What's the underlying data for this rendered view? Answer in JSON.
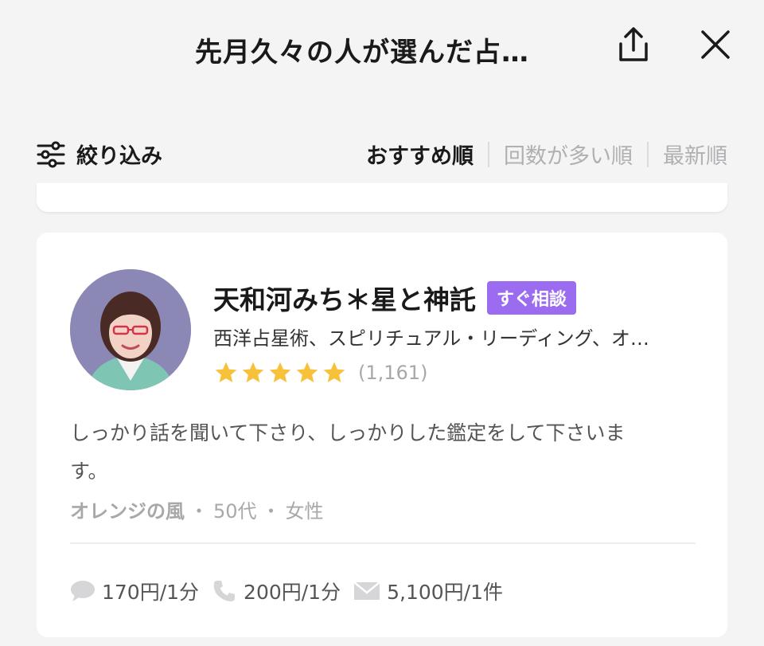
{
  "header": {
    "title": "先月久々の人が選んだ占…",
    "share_icon": "share-icon",
    "close_icon": "close-icon"
  },
  "filter": {
    "label": "絞り込み",
    "icon": "sliders-icon"
  },
  "sort": {
    "tabs": [
      {
        "label": "おすすめ順",
        "active": true
      },
      {
        "label": "回数が多い順",
        "active": false
      },
      {
        "label": "最新順",
        "active": false
      }
    ]
  },
  "card": {
    "name": "天和河みち＊星と神託",
    "badge": "すぐ相談",
    "genres": "西洋占星術、スピリチュアル・リーディング、オ…",
    "rating": 5,
    "review_count": "(1,161)",
    "review_line1": "しっかり話を聞いて下さり、しっかりした鑑定をして下さいま",
    "review_line2": "す。",
    "reviewer": {
      "name": "オレンジの風",
      "sep1": "・",
      "age": "50代",
      "sep2": "・",
      "gender": "女性"
    },
    "prices": {
      "chat": "170円/1分",
      "phone": "200円/1分",
      "mail": "5,100円/1件"
    },
    "colors": {
      "badge": "#9b6cf0",
      "star": "#f7c23a",
      "avatar_bg": "#8b88b5"
    }
  }
}
